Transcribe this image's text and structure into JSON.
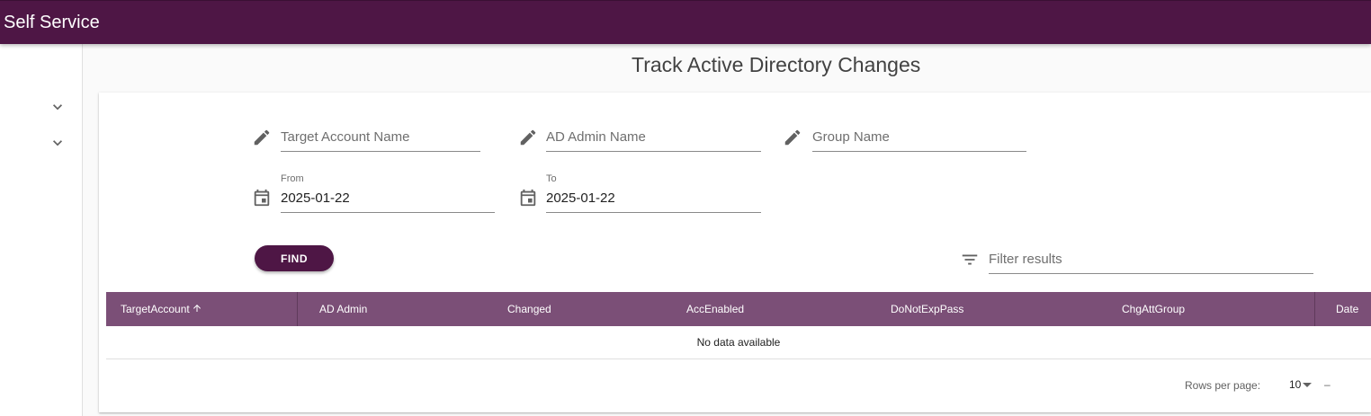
{
  "app": {
    "title": "Self Service"
  },
  "colors": {
    "brand": "#4e1645",
    "table_header": "#7b4f77"
  },
  "sidebar": {
    "items": [
      {
        "icon": "chevron-down-icon"
      },
      {
        "icon": "chevron-down-icon"
      }
    ]
  },
  "page": {
    "title": "Track Active Directory Changes"
  },
  "form": {
    "target_account": {
      "placeholder": "Target Account Name",
      "value": "",
      "icon": "pencil-icon"
    },
    "ad_admin": {
      "placeholder": "AD Admin Name",
      "value": "",
      "icon": "pencil-icon"
    },
    "group_name": {
      "placeholder": "Group Name",
      "value": "",
      "icon": "pencil-icon"
    },
    "from": {
      "label": "From",
      "value": "2025-01-22",
      "icon": "calendar-icon"
    },
    "to": {
      "label": "To",
      "value": "2025-01-22",
      "icon": "calendar-icon"
    },
    "find_label": "FIND"
  },
  "filter": {
    "placeholder": "Filter results",
    "value": "",
    "icon": "filter-icon"
  },
  "table": {
    "columns": [
      "TargetAccount",
      "AD Admin",
      "Changed",
      "AccEnabled",
      "DoNotExpPass",
      "ChgAttGroup",
      "Date"
    ],
    "sorted_column": "TargetAccount",
    "sort_direction": "ascending",
    "empty_text": "No data available"
  },
  "pagination": {
    "rows_per_page_label": "Rows per page:",
    "rows_per_page": "10",
    "range": "–"
  }
}
